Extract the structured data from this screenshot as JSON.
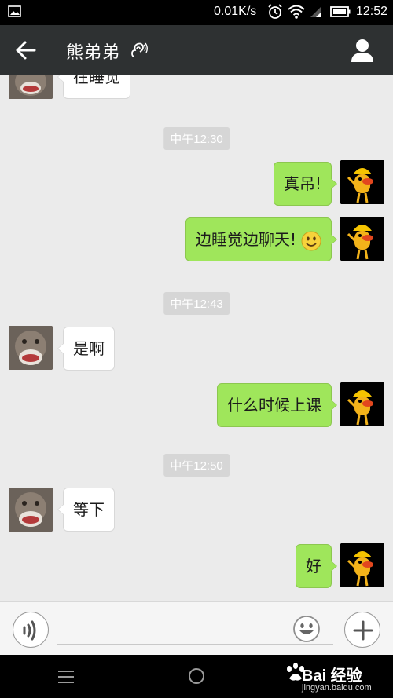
{
  "status_bar": {
    "network_speed": "0.01K/s",
    "time": "12:52",
    "icons": [
      "image-icon",
      "alarm-icon",
      "wifi-icon",
      "signal-icon",
      "battery-icon"
    ]
  },
  "header": {
    "title": "熊弟弟",
    "icons": [
      "back-arrow-icon",
      "earpiece-icon",
      "profile-icon"
    ],
    "background": "#2e3132"
  },
  "chat": {
    "messages": [
      {
        "sender": "peer",
        "text": "在睡觉"
      },
      {
        "type": "timestamp",
        "text": "中午12:30"
      },
      {
        "sender": "me",
        "text": "真吊!"
      },
      {
        "sender": "me",
        "text": "边睡觉边聊天!",
        "emoji": "smile-emoji"
      },
      {
        "type": "timestamp",
        "text": "中午12:43"
      },
      {
        "sender": "peer",
        "text": "是啊"
      },
      {
        "sender": "me",
        "text": "什么时候上课"
      },
      {
        "type": "timestamp",
        "text": "中午12:50"
      },
      {
        "sender": "peer",
        "text": "等下"
      },
      {
        "sender": "me",
        "text": "好"
      }
    ],
    "colors": {
      "my_bubble": "#9fe65b",
      "peer_bubble": "#ffffff",
      "background": "#ebebeb",
      "timestamp_bg": "#d6d6d6"
    }
  },
  "input_bar": {
    "value": "",
    "placeholder": "",
    "icons": [
      "voice-icon",
      "emoji-icon",
      "plus-icon"
    ]
  },
  "nav_bar": {
    "icons": [
      "menu-icon",
      "home-icon"
    ]
  },
  "watermark": {
    "brand": "Bai 经验",
    "url": "jingyan.baidu.com"
  }
}
